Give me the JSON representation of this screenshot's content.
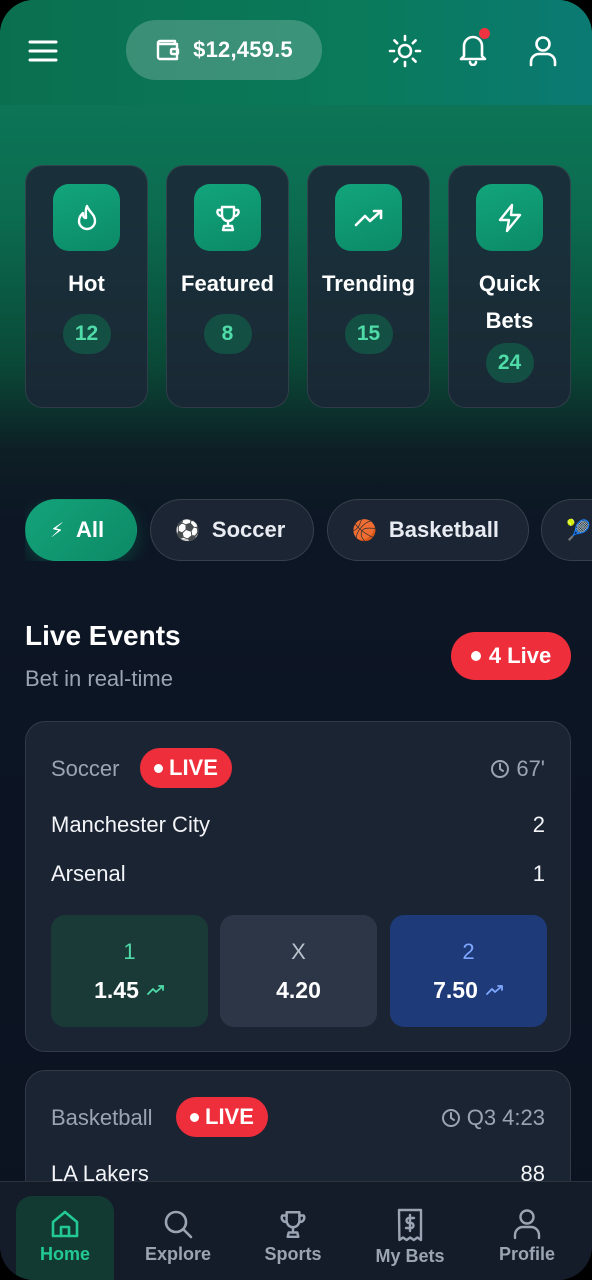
{
  "header": {
    "balance": "$12,459.5",
    "icons": [
      "menu-icon",
      "wallet-icon",
      "sun-icon",
      "bell-icon",
      "user-icon"
    ],
    "has_notification": true
  },
  "categories": [
    {
      "label": "Hot",
      "count": "12",
      "icon": "flame-icon"
    },
    {
      "label": "Featured",
      "count": "8",
      "icon": "trophy-icon"
    },
    {
      "label": "Trending",
      "count": "15",
      "icon": "trending-up-icon"
    },
    {
      "label": "Quick Bets",
      "count": "24",
      "icon": "zap-icon"
    }
  ],
  "filters": [
    {
      "label": "All",
      "emoji": "⚡",
      "active": true
    },
    {
      "label": "Soccer",
      "emoji": "⚽",
      "active": false
    },
    {
      "label": "Basketball",
      "emoji": "🏀",
      "active": false
    },
    {
      "label": "",
      "emoji": "🎾",
      "active": false
    }
  ],
  "live_section": {
    "title": "Live Events",
    "subtitle": "Bet in real-time",
    "badge": "4 Live"
  },
  "events": [
    {
      "sport": "Soccer",
      "status": "LIVE",
      "clock": "67'",
      "home": {
        "name": "Manchester City",
        "score": "2"
      },
      "away": {
        "name": "Arsenal",
        "score": "1"
      },
      "odds": {
        "home": {
          "key": "1",
          "value": "1.45"
        },
        "draw": {
          "key": "X",
          "value": "4.20"
        },
        "away": {
          "key": "2",
          "value": "7.50"
        }
      }
    },
    {
      "sport": "Basketball",
      "status": "LIVE",
      "clock": "Q3 4:23",
      "home": {
        "name": "LA Lakers",
        "score": "88"
      }
    }
  ],
  "nav": [
    {
      "label": "Home",
      "icon": "home-icon",
      "active": true
    },
    {
      "label": "Explore",
      "icon": "search-icon",
      "active": false
    },
    {
      "label": "Sports",
      "icon": "trophy-icon",
      "active": false
    },
    {
      "label": "My Bets",
      "icon": "receipt-icon",
      "active": false
    },
    {
      "label": "Profile",
      "icon": "user-icon",
      "active": false
    }
  ],
  "colors": {
    "accent": "#12a57c",
    "live": "#ef2e3c",
    "background": "#0b1220"
  }
}
